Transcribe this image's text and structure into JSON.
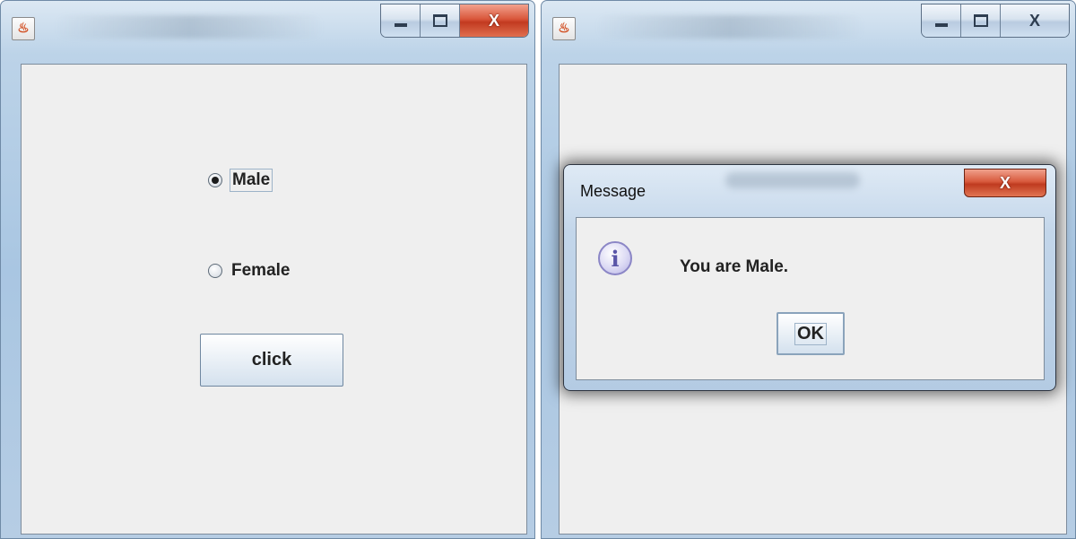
{
  "left_window": {
    "icon": "java-app-icon",
    "caption": {
      "close": "X"
    },
    "radios": [
      {
        "label": "Male",
        "selected": true
      },
      {
        "label": "Female",
        "selected": false
      }
    ],
    "button_label": "click"
  },
  "right_window": {
    "icon": "java-app-icon",
    "caption": {
      "close": "X"
    }
  },
  "dialog": {
    "title": "Message",
    "close": "X",
    "icon": "info-icon",
    "icon_glyph": "i",
    "message": "You are Male.",
    "ok_label": "OK"
  },
  "colors": {
    "close_button_red": "#c23a20",
    "client_bg": "#efefef",
    "frame_blue": "#a9c6e2"
  }
}
